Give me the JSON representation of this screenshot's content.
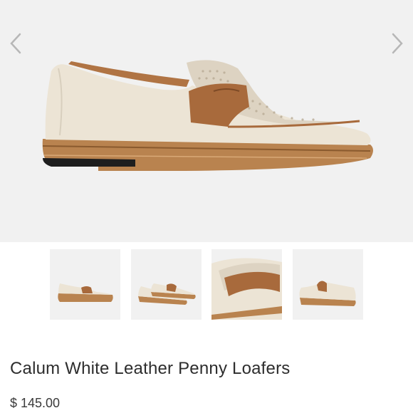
{
  "product": {
    "title": "Calum White Leather Penny Loafers",
    "price": "$ 145.00",
    "image_count": 4
  },
  "gallery": {
    "prev_icon": "chevron-left-icon",
    "next_icon": "chevron-right-icon",
    "thumbnails": [
      "thumbnail-side-view",
      "thumbnail-pair-view",
      "thumbnail-closeup",
      "thumbnail-rear-view"
    ]
  },
  "colors": {
    "background": "#f1f1f1",
    "leather_cream": "#ece4d5",
    "strap_tan": "#a86a3c",
    "sole_wood": "#b9834f"
  }
}
